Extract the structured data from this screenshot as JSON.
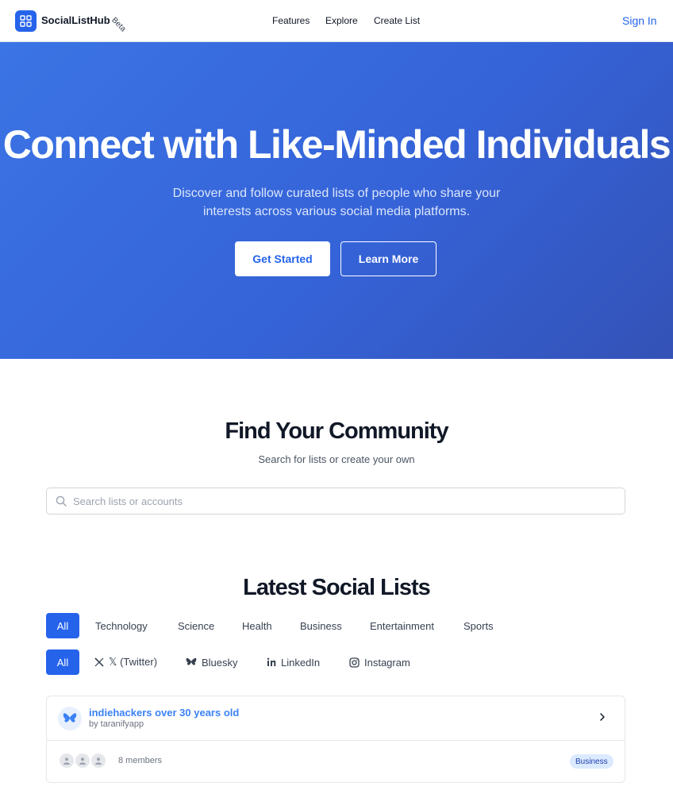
{
  "header": {
    "brand": "SocialListHub",
    "beta": "Beta",
    "nav": [
      "Features",
      "Explore",
      "Create List"
    ],
    "sign_in": "Sign In"
  },
  "hero": {
    "title": "Connect with Like-Minded Individuals",
    "subtitle": "Discover and follow curated lists of people who share your interests across various social media platforms.",
    "primary_button": "Get Started",
    "secondary_button": "Learn More"
  },
  "find": {
    "title": "Find Your Community",
    "subtitle": "Search for lists or create your own",
    "search_placeholder": "Search lists or accounts",
    "search_value": ""
  },
  "latest": {
    "title": "Latest Social Lists",
    "categories": [
      "All",
      "Technology",
      "Science",
      "Health",
      "Business",
      "Entertainment",
      "Sports"
    ],
    "active_category": "All",
    "platforms": [
      {
        "label": "All",
        "icon": ""
      },
      {
        "label": "𝕏 (Twitter)",
        "icon": "x-icon"
      },
      {
        "label": "Bluesky",
        "icon": "bluesky-icon"
      },
      {
        "label": "LinkedIn",
        "icon": "linkedin-icon"
      },
      {
        "label": "Instagram",
        "icon": "instagram-icon"
      }
    ],
    "active_platform": "All"
  },
  "list_card": {
    "title": "indiehackers over 30 years old",
    "byline": "by taranifyapp",
    "members": "8 members",
    "tag": "Business",
    "platform_icon": "bluesky-icon"
  },
  "colors": {
    "accent": "#2563eb",
    "hero_start": "#3b74e4",
    "hero_end": "#3452b7",
    "tag_bg": "#dbeafe"
  }
}
